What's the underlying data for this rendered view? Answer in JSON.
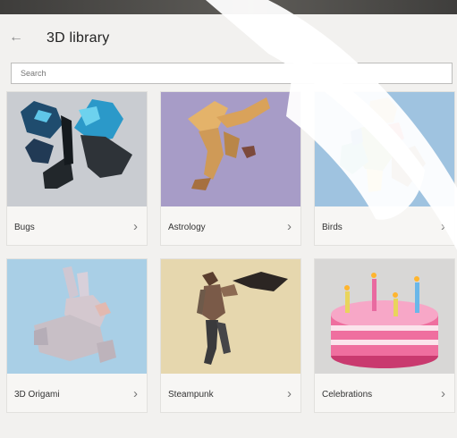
{
  "header": {
    "title": "3D library",
    "back_icon": "back-arrow-icon"
  },
  "search": {
    "placeholder": "Search",
    "value": ""
  },
  "categories": [
    {
      "label": "Bugs",
      "icon": "chevron-right-icon",
      "thumb_color": "#c9ccd1"
    },
    {
      "label": "Astrology",
      "icon": "chevron-right-icon",
      "thumb_color": "#a79cc7"
    },
    {
      "label": "Birds",
      "icon": "chevron-right-icon",
      "thumb_color": "#9fc3e0"
    },
    {
      "label": "3D Origami",
      "icon": "chevron-right-icon",
      "thumb_color": "#a9cfe6"
    },
    {
      "label": "Steampunk",
      "icon": "chevron-right-icon",
      "thumb_color": "#e6d7ae"
    },
    {
      "label": "Celebrations",
      "icon": "chevron-right-icon",
      "thumb_color": "#d8d7d6"
    }
  ],
  "chevron_glyph": "›",
  "back_glyph": "←"
}
